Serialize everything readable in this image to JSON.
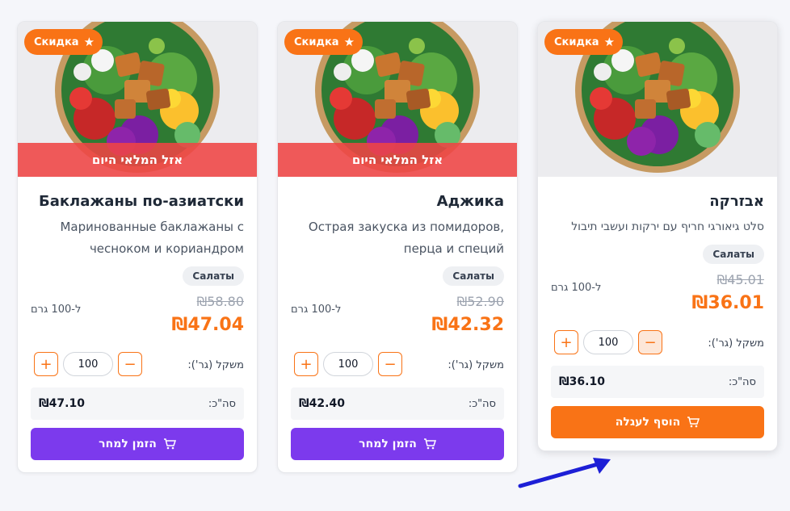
{
  "cards": [
    {
      "badge": "Скидка",
      "badge_icon": "star-icon",
      "soldout": "אזל המלאי היום",
      "title": "Баклажаны по-азиатски",
      "desc": "Маринованные баклажаны с чесноком и кориандром",
      "tag": "Салаты",
      "old_price": "₪58.80",
      "new_price": "₪47.04",
      "unit": "ל-100 גרם",
      "qty_label": "משקל (גר'):",
      "qty_value": "100",
      "total_label": "סה\"כ:",
      "total_value": "₪47.10",
      "action_label": "הזמן למחר",
      "action_color": "#7c3aed"
    },
    {
      "badge": "Скидка",
      "badge_icon": "star-icon",
      "soldout": "אזל המלאי היום",
      "title": "Аджика",
      "desc": "Острая закуска из помидоров, перца и специй",
      "tag": "Салаты",
      "old_price": "₪52.90",
      "new_price": "₪42.32",
      "unit": "ל-100 גרם",
      "qty_label": "משקל (גר'):",
      "qty_value": "100",
      "total_label": "סה\"כ:",
      "total_value": "₪42.40",
      "action_label": "הזמן למחר",
      "action_color": "#7c3aed"
    },
    {
      "badge": "Скидка",
      "badge_icon": "star-icon",
      "title": "אבזרקה",
      "desc": "סלט גיאורגי חריף עם ירקות ועשבי תיבול",
      "tag": "Салаты",
      "old_price": "₪45.01",
      "new_price": "₪36.01",
      "unit": "ל-100 גרם",
      "qty_label": "משקל (גר'):",
      "qty_value": "100",
      "total_label": "סה\"כ:",
      "total_value": "₪36.10",
      "action_label": "הוסף לעגלה",
      "action_color": "#f97316"
    }
  ],
  "colors": {
    "accent": "#f97316",
    "purple": "#7c3aed",
    "soldout": "#ef4444",
    "arrow": "#1d1fd6"
  }
}
